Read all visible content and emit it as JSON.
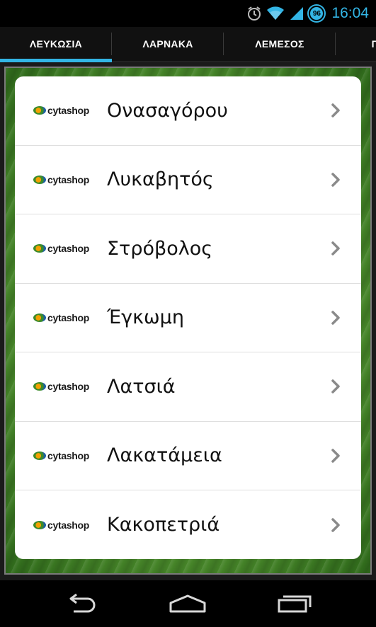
{
  "status_bar": {
    "time": "16:04",
    "battery_level": "96",
    "icons": [
      "alarm-icon",
      "wifi-icon",
      "signal-icon",
      "battery-icon"
    ]
  },
  "tabs": [
    {
      "label": "ΛΕΥΚΩΣΙΑ",
      "active": true
    },
    {
      "label": "ΛΑΡΝΑΚΑ",
      "active": false
    },
    {
      "label": "ΛΕΜΕΣΟΣ",
      "active": false
    },
    {
      "label": "Π",
      "active": false
    }
  ],
  "list": {
    "brand": "cytashop",
    "items": [
      {
        "label": "Ονασαγόρου"
      },
      {
        "label": "Λυκαβητός"
      },
      {
        "label": "Στρόβολος"
      },
      {
        "label": "Έγκωμη"
      },
      {
        "label": "Λατσιά"
      },
      {
        "label": "Λακατάμεια"
      },
      {
        "label": "Κακοπετριά"
      }
    ]
  },
  "colors": {
    "accent": "#33b5e5",
    "grass": "#4f8f2e"
  },
  "nav_bar": {
    "icons": [
      "back-icon",
      "home-icon",
      "recent-apps-icon"
    ]
  }
}
